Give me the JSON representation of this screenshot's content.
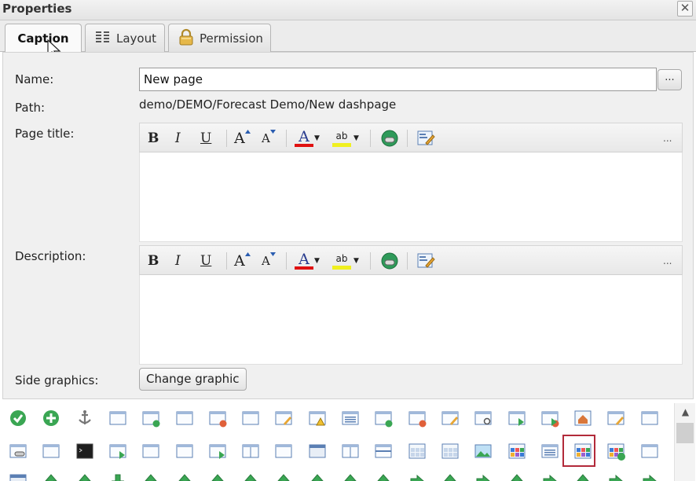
{
  "dialog": {
    "title": "Properties",
    "close_glyph": "✕"
  },
  "tabs": [
    {
      "label": "Caption",
      "active": true
    },
    {
      "label": "Layout",
      "icon": "layout-grid-icon"
    },
    {
      "label": "Permission",
      "icon": "lock-icon"
    }
  ],
  "form": {
    "name_label": "Name:",
    "name_value": "New page",
    "browse_label": "...",
    "path_label": "Path:",
    "path_value": "demo/DEMO/Forecast Demo/New dashpage",
    "page_title_label": "Page title:",
    "description_label": "Description:",
    "side_graphics_label": "Side graphics:",
    "change_graphic_label": "Change graphic"
  },
  "toolbar": {
    "bold": "B",
    "italic": "I",
    "underline": "U",
    "grow": "A",
    "shrink": "A",
    "font_color": "A",
    "highlight": "ab",
    "more": "..."
  },
  "colors": {
    "font_color_bar": "#e01010",
    "highlight_bar": "#f0f020",
    "selection": "#b22a3a"
  },
  "gallery": {
    "rows": 3,
    "selected_icon": "grid-tiles-icon"
  }
}
